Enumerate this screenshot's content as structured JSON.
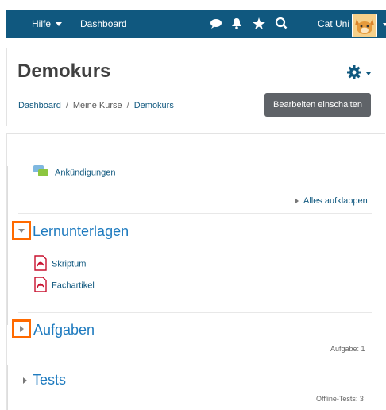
{
  "navbar": {
    "help_label": "Hilfe",
    "dashboard_label": "Dashboard",
    "user_name": "Cat Uni",
    "icons": [
      "chat-icon",
      "bell-icon",
      "star-icon",
      "search-icon"
    ]
  },
  "header": {
    "title": "Demokurs",
    "breadcrumb": [
      "Dashboard",
      "Meine Kurse",
      "Demokurs"
    ],
    "edit_button": "Bearbeiten einschalten"
  },
  "course": {
    "announcements": "Ankündigungen",
    "expand_all": "Alles aufklappen",
    "sections": [
      {
        "title": "Lernunterlagen",
        "items": [
          "Skriptum",
          "Fachartikel"
        ],
        "expanded": true
      },
      {
        "title": "Aufgaben",
        "count": "Aufgabe: 1",
        "expanded": false
      },
      {
        "title": "Tests",
        "count": "Offline-Tests: 3",
        "expanded": false
      }
    ]
  },
  "colors": {
    "navbar": "#10587f",
    "link": "#10587f",
    "section_title": "#1f7bbf",
    "highlight": "#ff6a00",
    "button": "#5f6368"
  }
}
